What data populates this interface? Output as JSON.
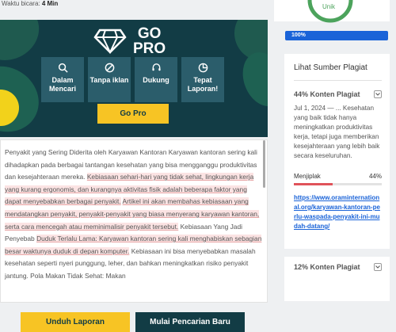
{
  "reading_time": {
    "label": "Waktu bicara:",
    "value": "4 Min"
  },
  "promo": {
    "title_line1": "GO",
    "title_line2": "PRO",
    "features": [
      {
        "label": "Dalam Mencari",
        "icon": "search-icon"
      },
      {
        "label": "Tanpa iklan",
        "icon": "no-ads-icon"
      },
      {
        "label": "Dukung",
        "icon": "headset-icon"
      },
      {
        "label": "Tepat Laporan!",
        "icon": "pie-chart-icon"
      }
    ],
    "button": "Go Pro"
  },
  "content": {
    "p1": "Penyakit yang Sering Diderita oleh Karyawan Kantoran Karyawan kantoran sering kali dihadapkan pada berbagai tantangan kesehatan yang bisa mengganggu produktivitas dan kesejahteraan mereka.",
    "h1": "Kebiasaan sehari-hari yang tidak sehat, lingkungan kerja yang kurang ergonomis, dan kurangnya aktivitas fisik adalah beberapa faktor yang dapat menyebabkan berbagai penyakit.",
    "h2": "Artikel ini akan membahas kebiasaan yang mendatangkan penyakit, penyakit-penyakit yang biasa menyerang karyawan kantoran, serta cara mencegah atau meminimalisir penyakit tersebut.",
    "p2": "Kebiasaan Yang Jadi Penyebab",
    "h3": "Duduk Terlalu Lama: Karyawan kantoran sering kali menghabiskan sebagian besar waktunya duduk di depan komputer.",
    "p3": "Kebiasaan ini bisa menyebabkan masalah kesehatan seperti nyeri punggung, leher, dan bahkan meningkatkan risiko penyakit jantung. Pola Makan Tidak Sehat: Makan"
  },
  "actions": {
    "download": "Unduh Laporan",
    "new_search": "Mulai Pencarian Baru"
  },
  "stats": {
    "unique_label": "Unik",
    "progress_text": "100%",
    "progress_value": 100
  },
  "sources": {
    "title": "Lihat Sumber Plagiat",
    "items": [
      {
        "header": "44% Konten Plagiat",
        "snippet": "Jul 1, 2024 — ... Kesehatan yang baik tidak hanya meningkatkan produktivitas kerja, tetapi juga memberikan kesejahteraan yang lebih baik secara keseluruhan.",
        "label": "Menjiplak",
        "percent": "44%",
        "percent_value": 44,
        "url": "https://www.oraminternational.org/karyawan-kantoran-perlu-waspada-penyakit-ini-mudah-datang/"
      },
      {
        "header": "12% Konten Plagiat"
      }
    ]
  },
  "colors": {
    "dark_teal": "#123c45",
    "yellow": "#f7c424",
    "blue": "#1a63d8",
    "red": "#e0535a",
    "green": "#4ca35c"
  }
}
